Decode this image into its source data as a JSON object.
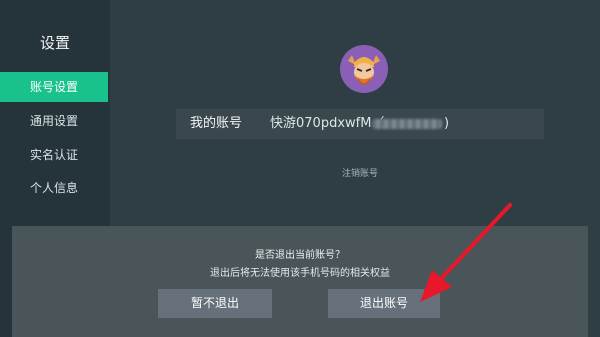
{
  "sidebar": {
    "title": "设置",
    "items": [
      {
        "label": "账号设置",
        "active": true
      },
      {
        "label": "通用设置",
        "active": false
      },
      {
        "label": "实名认证",
        "active": false
      },
      {
        "label": "个人信息",
        "active": false
      }
    ]
  },
  "account": {
    "label": "我的账号",
    "value": "快游070pdxwfM（",
    "closing": ")",
    "cancel_link": "注销账号",
    "avatar_icon": "warrior-avatar-icon"
  },
  "dialog": {
    "question": "是否退出当前账号？",
    "subtitle": "退出后将无法使用该手机号码的相关权益",
    "stay_button": "暂不退出",
    "exit_button": "退出账号"
  },
  "annotation": {
    "arrow_icon": "red-arrow-icon",
    "color": "#e8182a"
  },
  "colors": {
    "accent": "#19c28d",
    "sidebar_bg": "#25343a",
    "main_bg": "#2f3e44",
    "dialog_bg": "#4a5559",
    "button_bg": "#65707a"
  }
}
